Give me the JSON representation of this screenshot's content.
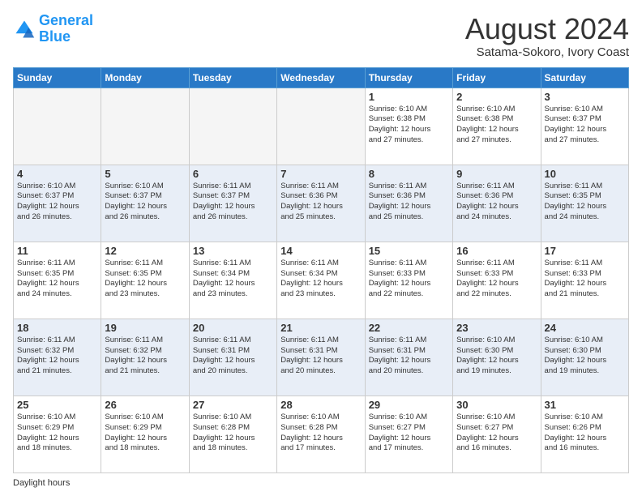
{
  "logo": {
    "line1": "General",
    "line2": "Blue"
  },
  "title": "August 2024",
  "subtitle": "Satama-Sokoro, Ivory Coast",
  "days_header": [
    "Sunday",
    "Monday",
    "Tuesday",
    "Wednesday",
    "Thursday",
    "Friday",
    "Saturday"
  ],
  "footer": "Daylight hours",
  "weeks": [
    {
      "row_class": "row-odd",
      "days": [
        {
          "num": "",
          "info": "",
          "empty": true
        },
        {
          "num": "",
          "info": "",
          "empty": true
        },
        {
          "num": "",
          "info": "",
          "empty": true
        },
        {
          "num": "",
          "info": "",
          "empty": true
        },
        {
          "num": "1",
          "info": "Sunrise: 6:10 AM\nSunset: 6:38 PM\nDaylight: 12 hours\nand 27 minutes.",
          "empty": false
        },
        {
          "num": "2",
          "info": "Sunrise: 6:10 AM\nSunset: 6:38 PM\nDaylight: 12 hours\nand 27 minutes.",
          "empty": false
        },
        {
          "num": "3",
          "info": "Sunrise: 6:10 AM\nSunset: 6:37 PM\nDaylight: 12 hours\nand 27 minutes.",
          "empty": false
        }
      ]
    },
    {
      "row_class": "row-even",
      "days": [
        {
          "num": "4",
          "info": "Sunrise: 6:10 AM\nSunset: 6:37 PM\nDaylight: 12 hours\nand 26 minutes.",
          "empty": false
        },
        {
          "num": "5",
          "info": "Sunrise: 6:10 AM\nSunset: 6:37 PM\nDaylight: 12 hours\nand 26 minutes.",
          "empty": false
        },
        {
          "num": "6",
          "info": "Sunrise: 6:11 AM\nSunset: 6:37 PM\nDaylight: 12 hours\nand 26 minutes.",
          "empty": false
        },
        {
          "num": "7",
          "info": "Sunrise: 6:11 AM\nSunset: 6:36 PM\nDaylight: 12 hours\nand 25 minutes.",
          "empty": false
        },
        {
          "num": "8",
          "info": "Sunrise: 6:11 AM\nSunset: 6:36 PM\nDaylight: 12 hours\nand 25 minutes.",
          "empty": false
        },
        {
          "num": "9",
          "info": "Sunrise: 6:11 AM\nSunset: 6:36 PM\nDaylight: 12 hours\nand 24 minutes.",
          "empty": false
        },
        {
          "num": "10",
          "info": "Sunrise: 6:11 AM\nSunset: 6:35 PM\nDaylight: 12 hours\nand 24 minutes.",
          "empty": false
        }
      ]
    },
    {
      "row_class": "row-odd",
      "days": [
        {
          "num": "11",
          "info": "Sunrise: 6:11 AM\nSunset: 6:35 PM\nDaylight: 12 hours\nand 24 minutes.",
          "empty": false
        },
        {
          "num": "12",
          "info": "Sunrise: 6:11 AM\nSunset: 6:35 PM\nDaylight: 12 hours\nand 23 minutes.",
          "empty": false
        },
        {
          "num": "13",
          "info": "Sunrise: 6:11 AM\nSunset: 6:34 PM\nDaylight: 12 hours\nand 23 minutes.",
          "empty": false
        },
        {
          "num": "14",
          "info": "Sunrise: 6:11 AM\nSunset: 6:34 PM\nDaylight: 12 hours\nand 23 minutes.",
          "empty": false
        },
        {
          "num": "15",
          "info": "Sunrise: 6:11 AM\nSunset: 6:33 PM\nDaylight: 12 hours\nand 22 minutes.",
          "empty": false
        },
        {
          "num": "16",
          "info": "Sunrise: 6:11 AM\nSunset: 6:33 PM\nDaylight: 12 hours\nand 22 minutes.",
          "empty": false
        },
        {
          "num": "17",
          "info": "Sunrise: 6:11 AM\nSunset: 6:33 PM\nDaylight: 12 hours\nand 21 minutes.",
          "empty": false
        }
      ]
    },
    {
      "row_class": "row-even",
      "days": [
        {
          "num": "18",
          "info": "Sunrise: 6:11 AM\nSunset: 6:32 PM\nDaylight: 12 hours\nand 21 minutes.",
          "empty": false
        },
        {
          "num": "19",
          "info": "Sunrise: 6:11 AM\nSunset: 6:32 PM\nDaylight: 12 hours\nand 21 minutes.",
          "empty": false
        },
        {
          "num": "20",
          "info": "Sunrise: 6:11 AM\nSunset: 6:31 PM\nDaylight: 12 hours\nand 20 minutes.",
          "empty": false
        },
        {
          "num": "21",
          "info": "Sunrise: 6:11 AM\nSunset: 6:31 PM\nDaylight: 12 hours\nand 20 minutes.",
          "empty": false
        },
        {
          "num": "22",
          "info": "Sunrise: 6:11 AM\nSunset: 6:31 PM\nDaylight: 12 hours\nand 20 minutes.",
          "empty": false
        },
        {
          "num": "23",
          "info": "Sunrise: 6:10 AM\nSunset: 6:30 PM\nDaylight: 12 hours\nand 19 minutes.",
          "empty": false
        },
        {
          "num": "24",
          "info": "Sunrise: 6:10 AM\nSunset: 6:30 PM\nDaylight: 12 hours\nand 19 minutes.",
          "empty": false
        }
      ]
    },
    {
      "row_class": "row-odd",
      "days": [
        {
          "num": "25",
          "info": "Sunrise: 6:10 AM\nSunset: 6:29 PM\nDaylight: 12 hours\nand 18 minutes.",
          "empty": false
        },
        {
          "num": "26",
          "info": "Sunrise: 6:10 AM\nSunset: 6:29 PM\nDaylight: 12 hours\nand 18 minutes.",
          "empty": false
        },
        {
          "num": "27",
          "info": "Sunrise: 6:10 AM\nSunset: 6:28 PM\nDaylight: 12 hours\nand 18 minutes.",
          "empty": false
        },
        {
          "num": "28",
          "info": "Sunrise: 6:10 AM\nSunset: 6:28 PM\nDaylight: 12 hours\nand 17 minutes.",
          "empty": false
        },
        {
          "num": "29",
          "info": "Sunrise: 6:10 AM\nSunset: 6:27 PM\nDaylight: 12 hours\nand 17 minutes.",
          "empty": false
        },
        {
          "num": "30",
          "info": "Sunrise: 6:10 AM\nSunset: 6:27 PM\nDaylight: 12 hours\nand 16 minutes.",
          "empty": false
        },
        {
          "num": "31",
          "info": "Sunrise: 6:10 AM\nSunset: 6:26 PM\nDaylight: 12 hours\nand 16 minutes.",
          "empty": false
        }
      ]
    }
  ]
}
